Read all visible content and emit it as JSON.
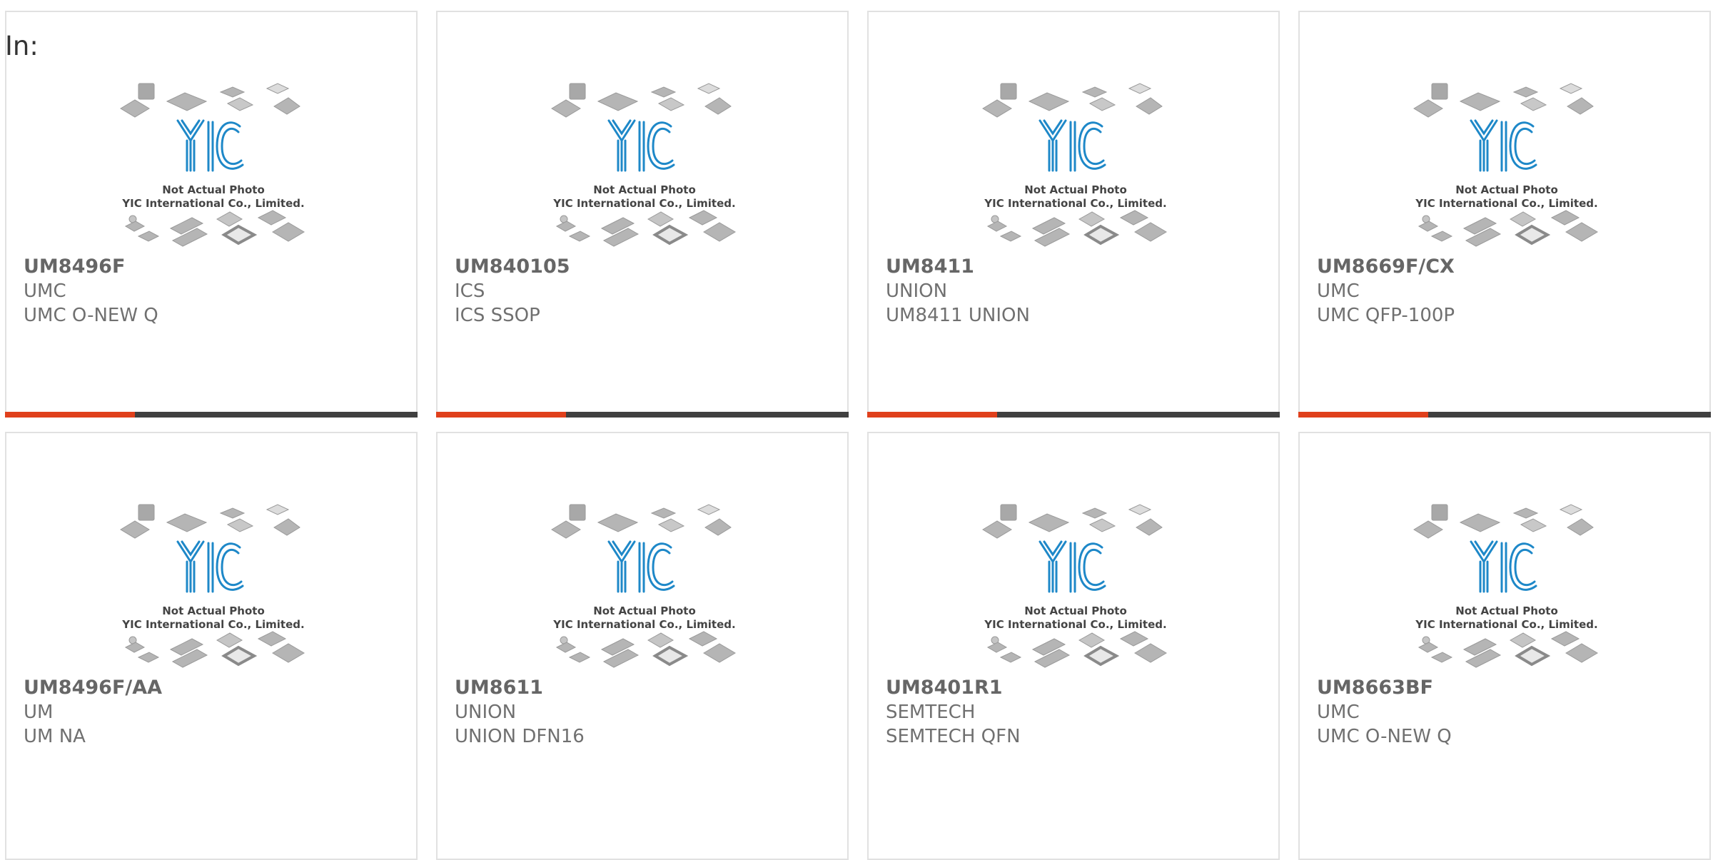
{
  "header": {
    "label": "In:"
  },
  "placeholder_image": {
    "logo_text": "YIC",
    "caption_line1": "Not Actual Photo",
    "caption_line2": "YIC International Co., Limited."
  },
  "colors": {
    "accent_bar": "#e0401c",
    "dark_bar": "#404040",
    "logo_blue": "#1e88c8",
    "card_border": "#e1e1e1"
  },
  "products": [
    {
      "part": "UM8496F",
      "brand": "UMC",
      "desc": "UMC O-NEW Q"
    },
    {
      "part": "UM840105",
      "brand": "ICS",
      "desc": "ICS SSOP"
    },
    {
      "part": "UM8411",
      "brand": "UNION",
      "desc": "UM8411 UNION"
    },
    {
      "part": "UM8669F/CX",
      "brand": "UMC",
      "desc": "UMC QFP-100P"
    },
    {
      "part": "UM8496F/AA",
      "brand": "UM",
      "desc": "UM NA"
    },
    {
      "part": "UM8611",
      "brand": "UNION",
      "desc": "UNION DFN16"
    },
    {
      "part": "UM8401R1",
      "brand": "SEMTECH",
      "desc": "SEMTECH QFN"
    },
    {
      "part": "UM8663BF",
      "brand": "UMC",
      "desc": "UMC O-NEW Q"
    }
  ]
}
